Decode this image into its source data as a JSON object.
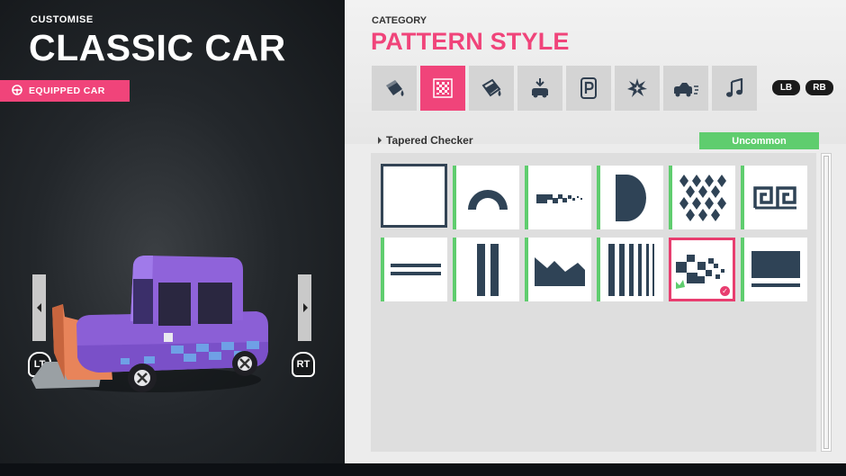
{
  "header": {
    "pretitle": "CUSTOMISE",
    "title": "CLASSIC CAR",
    "equipped_label": "EQUIPPED CAR"
  },
  "triggers": {
    "left": "LT",
    "right": "RT"
  },
  "panel": {
    "category_label": "CATEGORY",
    "category_name": "PATTERN STYLE",
    "tabs": [
      {
        "icon": "paint-bucket-icon"
      },
      {
        "icon": "pattern-grid-icon",
        "active": true
      },
      {
        "icon": "paint-bucket-drip-icon"
      },
      {
        "icon": "car-drop-icon"
      },
      {
        "icon": "parking-sign-icon"
      },
      {
        "icon": "explosion-icon"
      },
      {
        "icon": "car-speed-icon"
      },
      {
        "icon": "music-note-icon"
      }
    ],
    "bumpers": {
      "left": "LB",
      "right": "RB"
    },
    "selected_item": "Tapered Checker",
    "rarity": "Uncommon",
    "rarity_color": "#5fcd6e",
    "accent_color": "#f0447a"
  }
}
